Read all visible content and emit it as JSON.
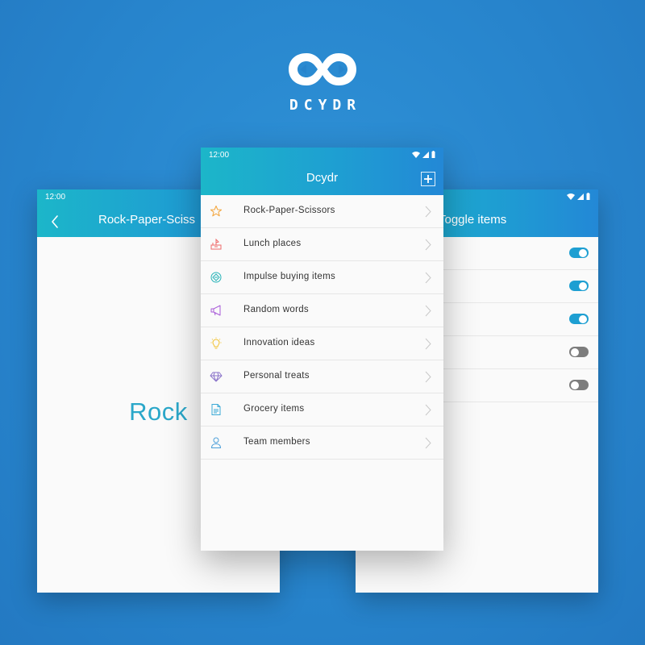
{
  "brand": {
    "name": "DCYDR",
    "color": "#ffffff"
  },
  "status_time": "12:00",
  "left_screen": {
    "title": "Rock-Paper-Sciss",
    "result": "Rock"
  },
  "center_screen": {
    "title": "Dcydr",
    "items": [
      {
        "label": "Rock-Paper-Scissors",
        "icon": "star-icon",
        "color": "#f3a43a"
      },
      {
        "label": "Lunch places",
        "icon": "lunch-icon",
        "color": "#ef6a6a"
      },
      {
        "label": "Impulse buying items",
        "icon": "tag-icon",
        "color": "#27b3b8"
      },
      {
        "label": "Random words",
        "icon": "megaphone-icon",
        "color": "#a85ad8"
      },
      {
        "label": "Innovation ideas",
        "icon": "lightbulb-icon",
        "color": "#f2c230"
      },
      {
        "label": "Personal treats",
        "icon": "diamond-icon",
        "color": "#8a73c9"
      },
      {
        "label": "Grocery items",
        "icon": "document-icon",
        "color": "#3aa9d6"
      },
      {
        "label": "Team members",
        "icon": "person-icon",
        "color": "#4c9fd9"
      }
    ]
  },
  "right_screen": {
    "title": "Toggle items",
    "toggles": [
      true,
      true,
      true,
      false,
      false
    ]
  },
  "colors": {
    "accent": "#1e9fd2",
    "background": "#2784cc",
    "rock_text": "#2aa7c9"
  }
}
